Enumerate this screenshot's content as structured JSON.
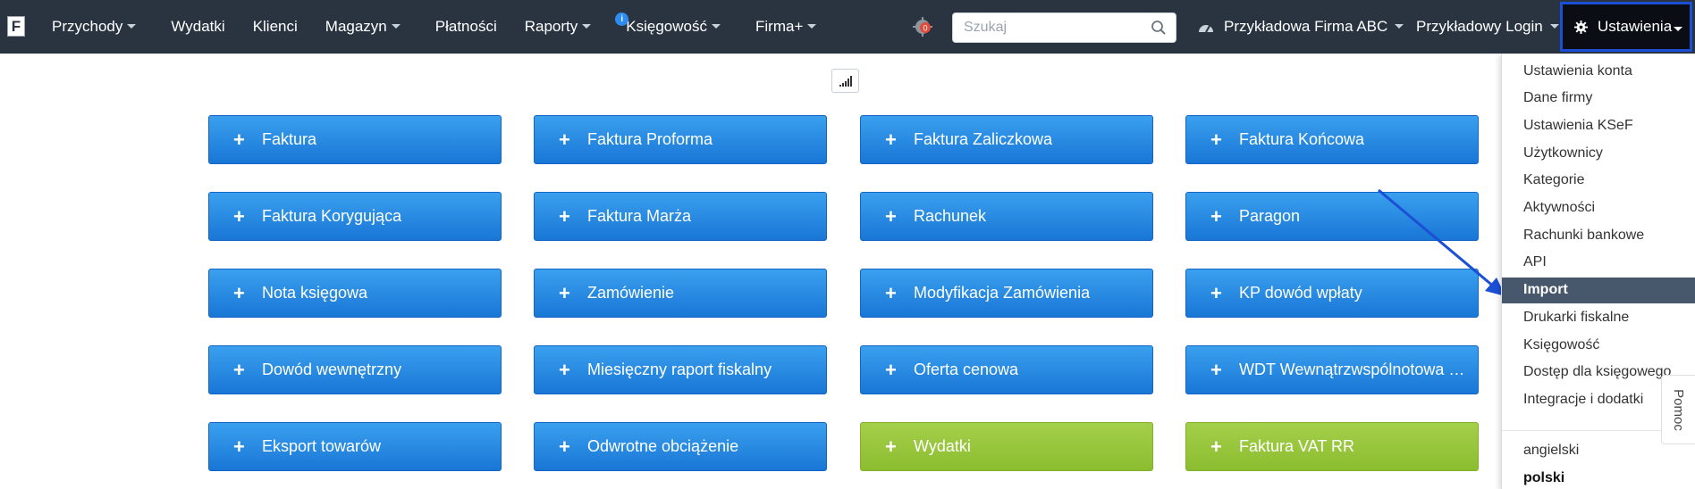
{
  "app": {
    "logo_letter": "F"
  },
  "nav": {
    "items": [
      {
        "label": "Przychody",
        "caret": true
      },
      {
        "label": "Wydatki",
        "caret": false
      },
      {
        "label": "Klienci",
        "caret": false
      },
      {
        "label": "Magazyn",
        "caret": true
      },
      {
        "label": "Płatności",
        "caret": false
      },
      {
        "label": "Raporty",
        "caret": true
      },
      {
        "label": "Księgowość",
        "caret": true,
        "badge": "i"
      },
      {
        "label": "Firma+",
        "caret": true
      }
    ],
    "status_badge_count": "0",
    "search": {
      "placeholder": "Szukaj",
      "value": ""
    },
    "company": "Przykładowa Firma ABC",
    "login": "Przykładowy Login",
    "settings": "Ustawienia"
  },
  "tiles": [
    {
      "label": "Faktura",
      "color": "blue"
    },
    {
      "label": "Faktura Proforma",
      "color": "blue"
    },
    {
      "label": "Faktura Zaliczkowa",
      "color": "blue"
    },
    {
      "label": "Faktura Końcowa",
      "color": "blue"
    },
    {
      "label": "Faktura Korygująca",
      "color": "blue"
    },
    {
      "label": "Faktura Marża",
      "color": "blue"
    },
    {
      "label": "Rachunek",
      "color": "blue"
    },
    {
      "label": "Paragon",
      "color": "blue"
    },
    {
      "label": "Nota księgowa",
      "color": "blue"
    },
    {
      "label": "Zamówienie",
      "color": "blue"
    },
    {
      "label": "Modyfikacja Zamówienia",
      "color": "blue"
    },
    {
      "label": "KP dowód wpłaty",
      "color": "blue"
    },
    {
      "label": "Dowód wewnętrzny",
      "color": "blue"
    },
    {
      "label": "Miesięczny raport fiskalny",
      "color": "blue"
    },
    {
      "label": "Oferta cenowa",
      "color": "blue"
    },
    {
      "label": "WDT Wewnątrzwspólnotowa …",
      "color": "blue"
    },
    {
      "label": "Eksport towarów",
      "color": "blue"
    },
    {
      "label": "Odwrotne obciążenie",
      "color": "blue"
    },
    {
      "label": "Wydatki",
      "color": "green"
    },
    {
      "label": "Faktura VAT RR",
      "color": "green"
    }
  ],
  "tile_plus": "+",
  "settings_menu": {
    "items": [
      {
        "label": "Ustawienia konta"
      },
      {
        "label": "Dane firmy"
      },
      {
        "label": "Ustawienia KSeF"
      },
      {
        "label": "Użytkownicy"
      },
      {
        "label": "Kategorie"
      },
      {
        "label": "Aktywności"
      },
      {
        "label": "Rachunki bankowe"
      },
      {
        "label": "API"
      },
      {
        "label": "Import",
        "active": true
      },
      {
        "label": "Drukarki fiskalne"
      },
      {
        "label": "Księgowość"
      },
      {
        "label": "Dostęp dla księgowego"
      },
      {
        "label": "Integracje i dodatki"
      }
    ],
    "languages": [
      {
        "label": "angielski",
        "selected": false
      },
      {
        "label": "polski",
        "selected": true
      }
    ]
  },
  "help_tab": "Pomoc",
  "colors": {
    "topbar": "#2a3440",
    "tile_blue": "#1f86e0",
    "tile_green": "#95c43b",
    "menu_active": "#47586c",
    "annotation_arrow": "#1a4fd6"
  }
}
